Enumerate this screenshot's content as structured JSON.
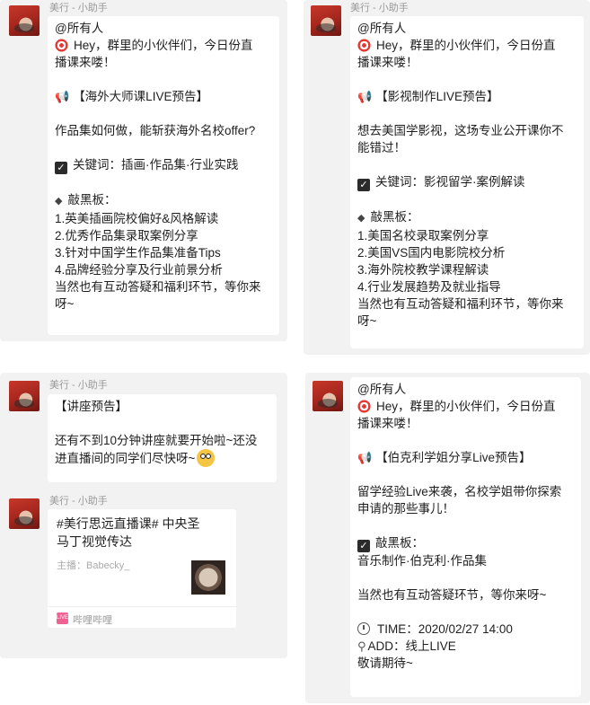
{
  "panels": [
    {
      "sender": "美行 - 小助手",
      "lines": [
        {
          "text": "@所有人"
        },
        {
          "icon": "target-icon",
          "text": "Hey，群里的小伙伴们，今日份直"
        },
        {
          "text": "播课来喽！"
        },
        {
          "text": ""
        },
        {
          "icon": "megaphone-icon",
          "text": "【海外大师课LIVE预告】"
        },
        {
          "text": ""
        },
        {
          "text": "作品集如何做，能斩获海外名校offer?"
        },
        {
          "text": ""
        },
        {
          "icon": "check-icon",
          "text": "关键词：插画·作品集·行业实践"
        },
        {
          "text": ""
        },
        {
          "icon": "diamond-icon",
          "text": "敲黑板："
        },
        {
          "text": "1.英美插画院校偏好&风格解读"
        },
        {
          "text": "2.优秀作品集录取案例分享"
        },
        {
          "text": "3.针对中国学生作品集准备Tips"
        },
        {
          "text": "4.品牌经验分享及行业前景分析"
        },
        {
          "text": "当然也有互动答疑和福利环节，等你来"
        },
        {
          "text": "呀~"
        }
      ]
    },
    {
      "sender": "美行 - 小助手",
      "lines": [
        {
          "text": "@所有人"
        },
        {
          "icon": "target-icon",
          "text": "Hey，群里的小伙伴们，今日份直"
        },
        {
          "text": "播课来喽！"
        },
        {
          "text": ""
        },
        {
          "icon": "megaphone-icon",
          "text": "【影视制作LIVE预告】"
        },
        {
          "text": ""
        },
        {
          "text": "想去美国学影视，这场专业公开课你不"
        },
        {
          "text": "能错过！"
        },
        {
          "text": ""
        },
        {
          "icon": "check-icon",
          "text": "关键词：影视留学·案例解读"
        },
        {
          "text": ""
        },
        {
          "icon": "diamond-icon",
          "text": "敲黑板："
        },
        {
          "text": "1.美国名校录取案例分享"
        },
        {
          "text": "2.美国VS国内电影院校分析"
        },
        {
          "text": "3.海外院校教学课程解读"
        },
        {
          "text": "4.行业发展趋势及就业指导"
        },
        {
          "text": "当然也有互动答疑和福利环节，等你来"
        },
        {
          "text": "呀~"
        }
      ]
    },
    {
      "sender": "美行 - 小助手",
      "lines": [
        {
          "text": "【讲座预告】"
        },
        {
          "text": ""
        },
        {
          "text": "还有不到10分钟讲座就要开始啦~还没"
        },
        {
          "text": "进直播间的同学们尽快呀~",
          "emoji": true
        }
      ],
      "second_sender": "美行 - 小助手",
      "card": {
        "title": "#美行思远直播课# 中央圣马丁视觉传达",
        "host": "主播：Babecky_",
        "source": "哔哩哔哩",
        "source_logo": "LIVE"
      }
    },
    {
      "lines": [
        {
          "text": "@所有人"
        },
        {
          "icon": "target-icon",
          "text": "Hey，群里的小伙伴们，今日份直"
        },
        {
          "text": "播课来喽！"
        },
        {
          "text": ""
        },
        {
          "icon": "megaphone-icon",
          "text": "【伯克利学姐分享Live预告】"
        },
        {
          "text": ""
        },
        {
          "text": "留学经验Live来袭，名校学姐带你探索"
        },
        {
          "text": "申请的那些事儿！"
        },
        {
          "text": ""
        },
        {
          "icon": "check-icon",
          "text": "敲黑板："
        },
        {
          "text": "音乐制作·伯克利·作品集"
        },
        {
          "text": ""
        },
        {
          "text": "当然也有互动答疑环节，等你来呀~"
        },
        {
          "text": ""
        },
        {
          "icon": "clock-icon",
          "text": "TIME：2020/02/27 14:00"
        },
        {
          "icon": "pin-icon",
          "text": "ADD：线上LIVE"
        },
        {
          "text": "敬请期待~"
        }
      ]
    }
  ]
}
